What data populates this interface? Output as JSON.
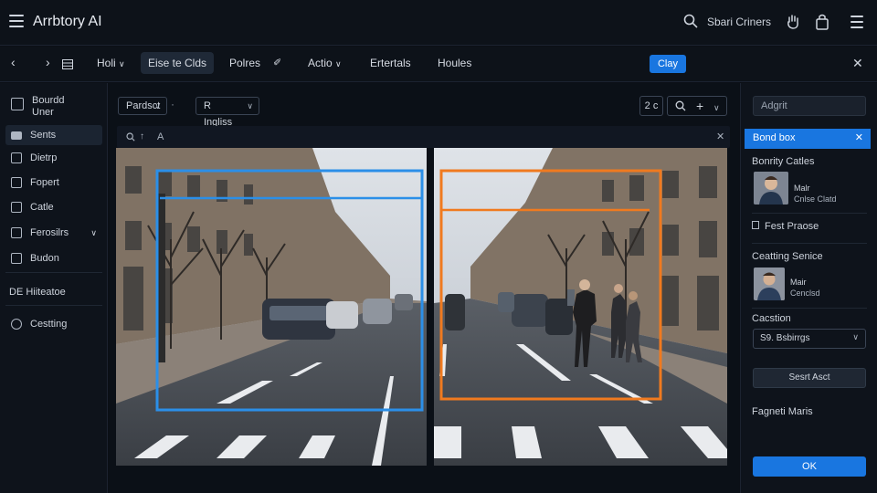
{
  "app": {
    "title": "Arrbtory AI"
  },
  "header": {
    "search_label": "Sbari Criners"
  },
  "toolbar": {
    "items": [
      "Holi",
      "Eise te Clds",
      "Polres",
      "Actio",
      "Ertertals",
      "Houles"
    ],
    "clay_label": "Clay"
  },
  "sidebar": {
    "top": [
      "Bourdd",
      "Uner"
    ],
    "items": [
      "Sents",
      "Dietrp",
      "Fopert",
      "Catle",
      "Ferosilrs",
      "Budon"
    ],
    "section": "DE Hiiteatoe",
    "bottom": "Cestting"
  },
  "canvas": {
    "dropdown_1": "Pardsct",
    "dropdown_2": "R Ingliss",
    "zoom_value": "2 c",
    "search_text": "A"
  },
  "panel": {
    "search_placeholder": "Adgrit",
    "bbox_header": "Bond box",
    "section_1": "Bonrity Catles",
    "person_1": {
      "name": "Malr",
      "sub": "Cnlse Clatd"
    },
    "item_link": "Fest Praose",
    "section_2": "Ceatting Senice",
    "person_2": {
      "name": "Mair",
      "sub": "Cenclsd"
    },
    "section_3": "Cacstion",
    "select_value": "S9. Bsbirrgs",
    "button_secondary": "Sesrt Asct",
    "section_4": "Fagneti Maris",
    "ok": "OK"
  },
  "colors": {
    "accent": "#1976e0",
    "box_left": "#2b8fe8",
    "box_right": "#f07a1f"
  }
}
